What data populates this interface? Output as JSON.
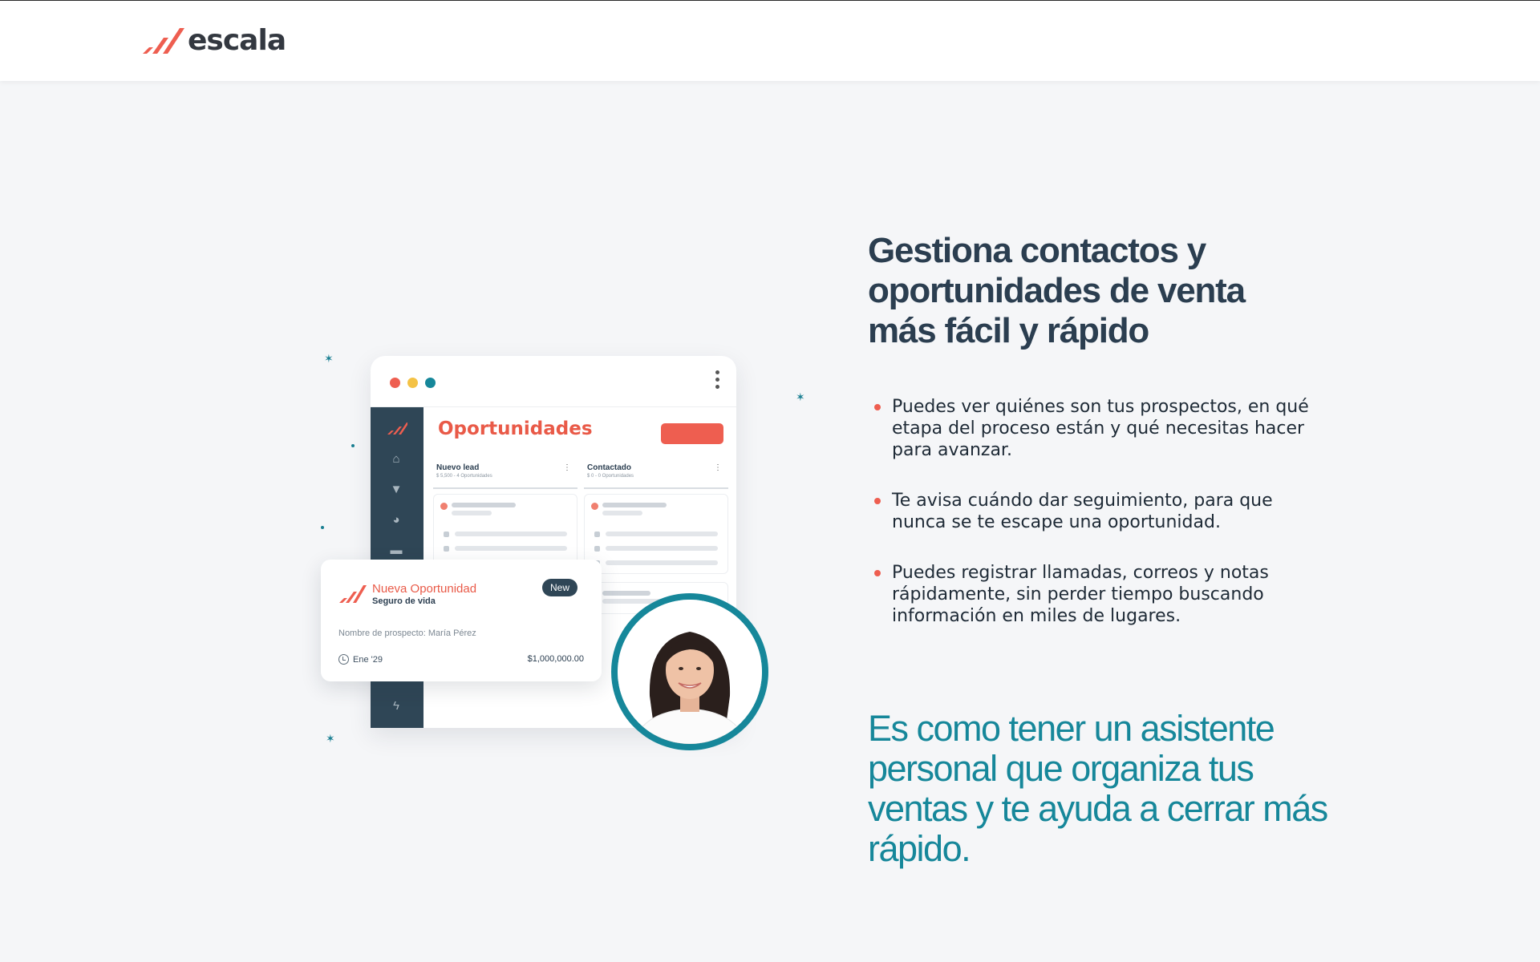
{
  "brand": {
    "name": "escala",
    "accent": "#ee5e50",
    "teal": "#16879a",
    "navy": "#2b3e50"
  },
  "illustration": {
    "window_title": "Oportunidades",
    "columns": [
      {
        "title": "Nuevo lead",
        "subtitle": "$ 5,500 - 4 Oportunidades"
      },
      {
        "title": "Contactado",
        "subtitle": "$ 0 - 0 Oportunidades"
      }
    ],
    "sidebar_icons": [
      "logo-icon",
      "home-icon",
      "filter-icon",
      "pie-chart-icon",
      "calendar-icon",
      "bolt-icon"
    ],
    "notification": {
      "title": "Nueva Oportunidad",
      "subtitle": "Seguro de vida",
      "badge": "New",
      "prospect": "Nombre de prospecto: María Pérez",
      "date": "Ene '29",
      "amount": "$1,000,000.00"
    }
  },
  "content": {
    "headline": "Gestiona contactos y oportunidades de venta más fácil y rápido",
    "bullets": [
      "Puedes ver quiénes son tus prospectos, en qué etapa del proceso están y qué necesitas hacer para avanzar.",
      "Te avisa cuándo dar seguimiento, para que nunca se te escape una oportunidad.",
      "Puedes registrar llamadas, correos y notas rápidamente, sin perder tiempo buscando información en miles de lugares."
    ],
    "tagline": "Es como tener un asistente personal que organiza tus ventas y te ayuda a cerrar más rápido."
  }
}
